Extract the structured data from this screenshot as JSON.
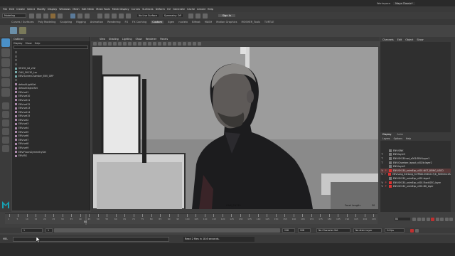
{
  "topbar": {
    "workspace_label": "Workspace",
    "workspace_value": "Maya Classic*",
    "menus": [
      "File",
      "Edit",
      "Create",
      "Select",
      "Modify",
      "Display",
      "Windows",
      "Mesh",
      "Edit Mesh",
      "Mesh Tools",
      "Mesh Display",
      "Curves",
      "Surfaces",
      "Deform",
      "UV",
      "Generate",
      "Cache",
      "Arnold",
      "Help"
    ]
  },
  "statusline": {
    "mode": "Modeling",
    "no_live_surface": "No Live Surface",
    "symmetry": "Symmetry: Off",
    "sign_in": "Sign In"
  },
  "shelf_tabs": [
    "Curves / Surfaces",
    "Poly Modeling",
    "Sculpting",
    "Rigging",
    "Animation",
    "Rendering",
    "FX",
    "FX Caching",
    "Custom",
    "Xgen",
    "nucleix",
    "Bifrost",
    "MASH",
    "Motion Graphics",
    "MOSHER_Tools",
    "TURTLE"
  ],
  "active_shelf": "Custom",
  "outliner": {
    "title": "Outliner",
    "menu": [
      "Display",
      "Show",
      "Help"
    ],
    "items": [
      "",
      "",
      "",
      "",
      "SH130_lot_v02",
      "CAM_SH130_Loc",
      "ENV:ScreenChamber_ENV_GRP",
      "",
      "defaultLightSet",
      "defaultObjectSet",
      "ENV:set1",
      "ENV:set10",
      "ENV:set11",
      "ENV:set12",
      "ENV:set13",
      "ENV:set14",
      "ENV:set15",
      "ENV:set2",
      "ENV:set3",
      "ENV:set4",
      "ENV:set5",
      "ENV:set6",
      "ENV:set7",
      "ENV:set8",
      "ENV:set9",
      "ENV:FloorsSymmetrySet",
      "ENV:BG"
    ]
  },
  "viewport": {
    "menu": [
      "View",
      "Shading",
      "Lighting",
      "Show",
      "Renderer",
      "Panels"
    ],
    "camera_label": "CAM_SH130",
    "focal_length_label": "Focal Length:",
    "focal_length_value": "50"
  },
  "channelbox": {
    "menu": [
      "Channels",
      "Edit",
      "Object",
      "Show"
    ],
    "layer_tabs": [
      "Display",
      "Anim"
    ],
    "layer_menu": [
      "Layers",
      "Options",
      "Help"
    ],
    "layers": [
      {
        "v": "",
        "r": "",
        "name": "ENV:SINK"
      },
      {
        "v": "T",
        "r": "",
        "name": "ENV:layer3"
      },
      {
        "v": "T",
        "r": "",
        "name": "ENV:SH130:set_v001:ENV:Layer1"
      },
      {
        "v": "T",
        "r": "",
        "name": "ENV:Chamber_layout_v002b:layer2"
      },
      {
        "v": "",
        "r": "",
        "name": "ENV:layer2"
      },
      {
        "v": "V",
        "r": "P",
        "name": "ENV:SH130_animExp_v001:NOT_BEING_USED"
      },
      {
        "v": "V",
        "r": "P",
        "name": "ENV:song_04:Song_ICVFBk0.0040217(4)_ReferenceScale"
      },
      {
        "v": "",
        "r": "",
        "name": "ENV:SH130_animExp_v001:layer1"
      },
      {
        "v": "V",
        "r": "P",
        "name": "ENV:SH130_animExp_v001:TrackGEO_layer"
      },
      {
        "v": "V",
        "r": "P",
        "name": "ENV:SH130_animExp_v001:BG_layer"
      }
    ]
  },
  "timeline": {
    "tick_labels": [
      "1",
      "5",
      "10",
      "15",
      "20",
      "25",
      "30",
      "35",
      "40",
      "45",
      "50",
      "55",
      "60",
      "65",
      "70",
      "75",
      "80",
      "85",
      "90",
      "95",
      "100",
      "105",
      "110",
      "115",
      "120",
      "125",
      "130",
      "135",
      "140",
      "145",
      "150",
      "155",
      "160",
      "165",
      "170",
      "175",
      "180",
      "185",
      "190",
      "195",
      "200",
      "205"
    ],
    "current_frame": "84",
    "start": "1",
    "end_inner": "208",
    "end_outer": "208",
    "start_inner": "1",
    "no_character_set": "No Character Set",
    "no_anim_layer": "No Anim Layer",
    "fps": "24 fps"
  },
  "cmdline": {
    "label": "MEL",
    "result": "Read 2 files in 18.6 seconds."
  }
}
